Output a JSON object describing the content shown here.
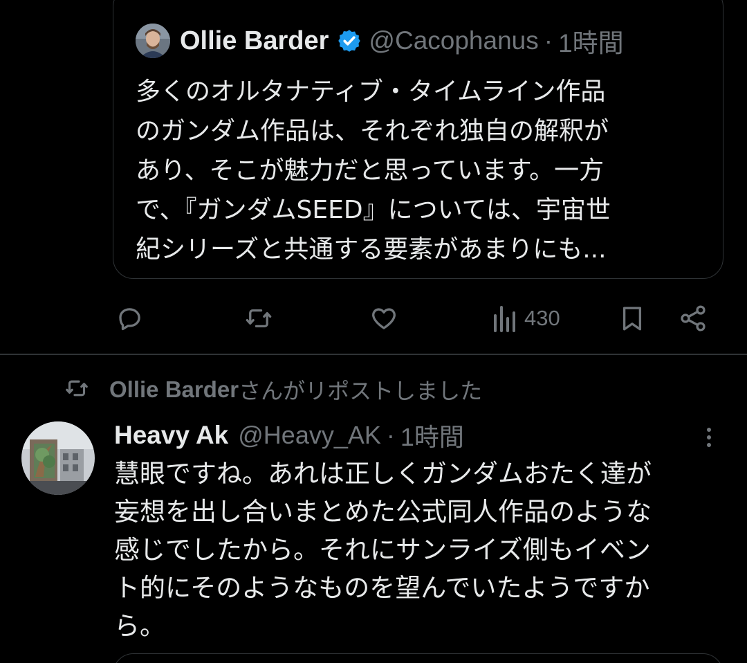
{
  "quoted_tweet": {
    "author_name": "Ollie Barder",
    "handle": "@Cacophanus",
    "separator": "·",
    "time": "1時間",
    "text_lines": [
      "多くのオルタナティブ・タイムライン作品",
      "のガンダム作品は、それぞれ独自の解釈が",
      "あり、そこが魅力だと思っています。一方",
      "で、『ガンダムSEED』については、宇宙世",
      "紀シリーズと共通する要素があまりにも..."
    ]
  },
  "actions": {
    "views_count": "430",
    "icons": [
      "reply-icon",
      "retweet-icon",
      "like-icon",
      "views-icon",
      "bookmark-icon",
      "share-icon"
    ]
  },
  "repost_notice": {
    "name": "Ollie Barder",
    "text": "さんがリポストしました"
  },
  "tweet": {
    "author_name": "Heavy Ak",
    "handle": "@Heavy_AK",
    "separator": "·",
    "time": "1時間",
    "text_lines": [
      "慧眼ですね。あれは正しくガンダムおたく達が",
      "妄想を出し合いまとめた公式同人作品のような",
      "感じでしたから。それにサンライズ側もイベン",
      "ト的にそのようなものを望んでいたようですか",
      "ら。"
    ]
  },
  "colors": {
    "background": "#000000",
    "primary_text": "#e7e9ea",
    "secondary_text": "#71767b",
    "border": "#2f3336",
    "verified_badge": "#1d9bf0"
  }
}
